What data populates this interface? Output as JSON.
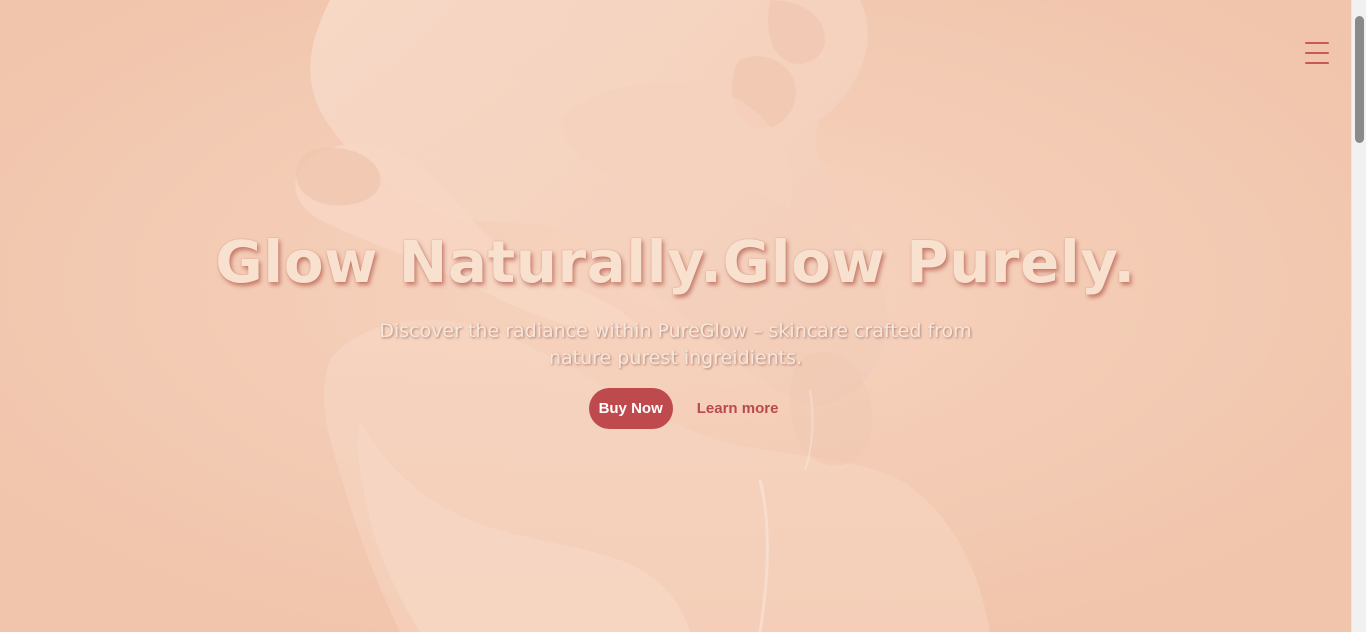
{
  "nav": {
    "menu_icon": "hamburger-menu-icon"
  },
  "hero": {
    "background_image": "hands-touching-photo",
    "headline": "Glow Naturally.Glow Purely.",
    "subtitle": "Discover the radiance within PureGlow – skincare crafted from nature purest ingreidients.",
    "buy_label": "Buy Now",
    "learn_label": "Learn more"
  },
  "colors": {
    "background": "#f2c6ae",
    "accent": "#bf4a4d",
    "headline_text": "#f8e2cf"
  }
}
